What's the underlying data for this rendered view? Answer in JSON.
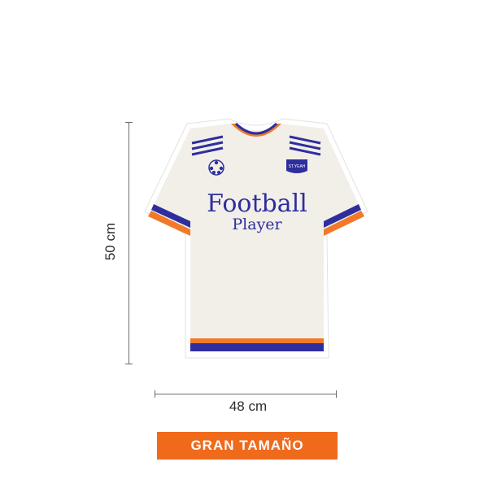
{
  "dimensions": {
    "height_label": "50 cm",
    "width_label": "48 cm"
  },
  "jersey": {
    "line1": "Football",
    "line2": "Player",
    "crest_text": "ST.YEAH",
    "colors": {
      "body": "#f2efe9",
      "accent_blue": "#2e2e9e",
      "accent_orange": "#f07a2a"
    }
  },
  "badge": {
    "label": "GRAN TAMAÑO",
    "color": "#f06a1c"
  }
}
